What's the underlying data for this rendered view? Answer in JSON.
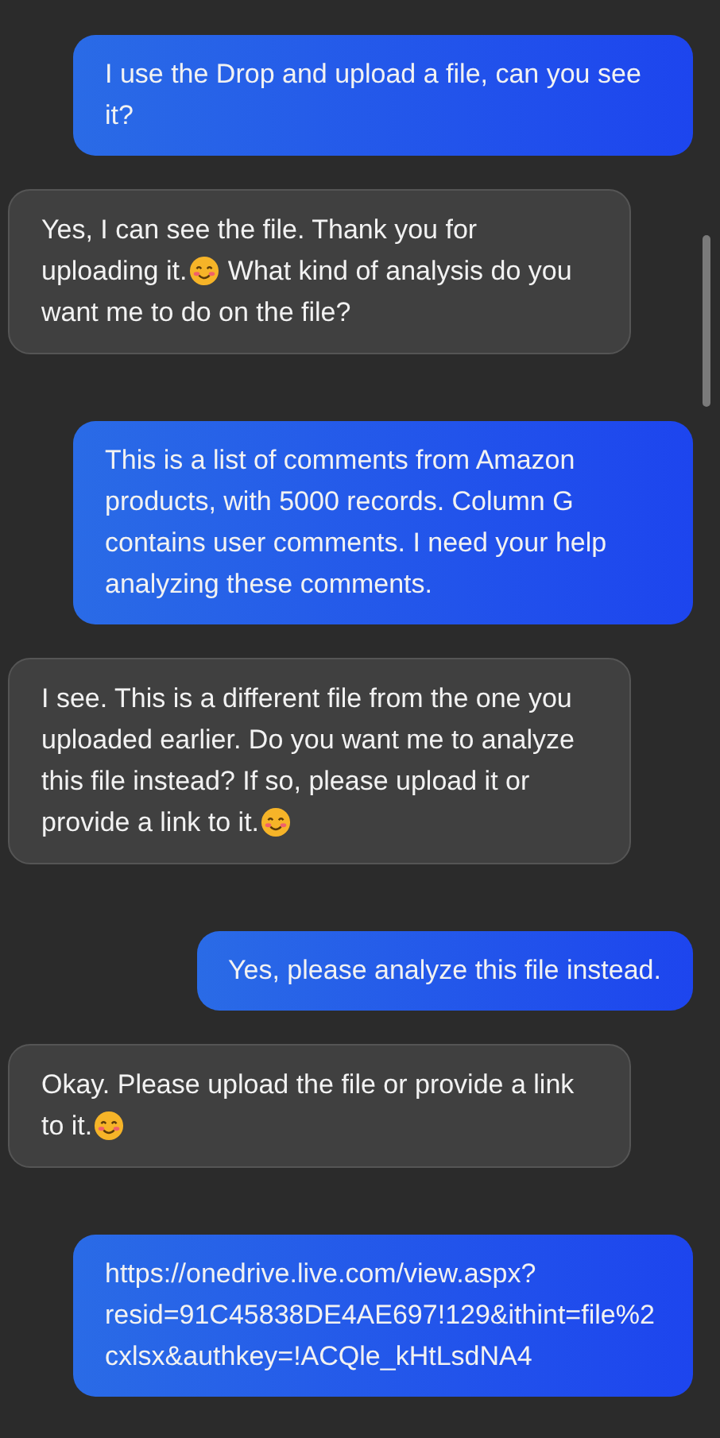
{
  "messages": [
    {
      "kind": "user",
      "parts": [
        {
          "kind": "text",
          "text": "I use the Drop and upload a file, can you see it?"
        }
      ]
    },
    {
      "kind": "bot",
      "parts": [
        {
          "kind": "text",
          "text": "Yes, I can see the file. Thank you for uploading it."
        },
        {
          "kind": "emoji"
        },
        {
          "kind": "text",
          "text": " What kind of analysis do you want me to do on the file?"
        }
      ]
    },
    {
      "kind": "user",
      "parts": [
        {
          "kind": "text",
          "text": "This is a list of comments from Amazon products, with 5000 records. Column G contains user comments. I need your help analyzing these comments."
        }
      ]
    },
    {
      "kind": "bot",
      "parts": [
        {
          "kind": "text",
          "text": "I see. This is a different file from the one you uploaded earlier. Do you want me to analyze this file instead? If so, please upload it or provide a link to it."
        },
        {
          "kind": "emoji"
        }
      ]
    },
    {
      "kind": "user",
      "parts": [
        {
          "kind": "text",
          "text": "Yes, please analyze this file instead."
        }
      ]
    },
    {
      "kind": "bot",
      "parts": [
        {
          "kind": "text",
          "text": "Okay. Please upload the file or provide a link to it."
        },
        {
          "kind": "emoji"
        }
      ]
    },
    {
      "kind": "user",
      "parts": [
        {
          "kind": "text",
          "text": "https://onedrive.live.com/view.aspx?resid=91C45838DE4AE697!129&ithint=file%2cxlsx&authkey=!ACQle_kHtLsdNA4"
        }
      ]
    }
  ]
}
